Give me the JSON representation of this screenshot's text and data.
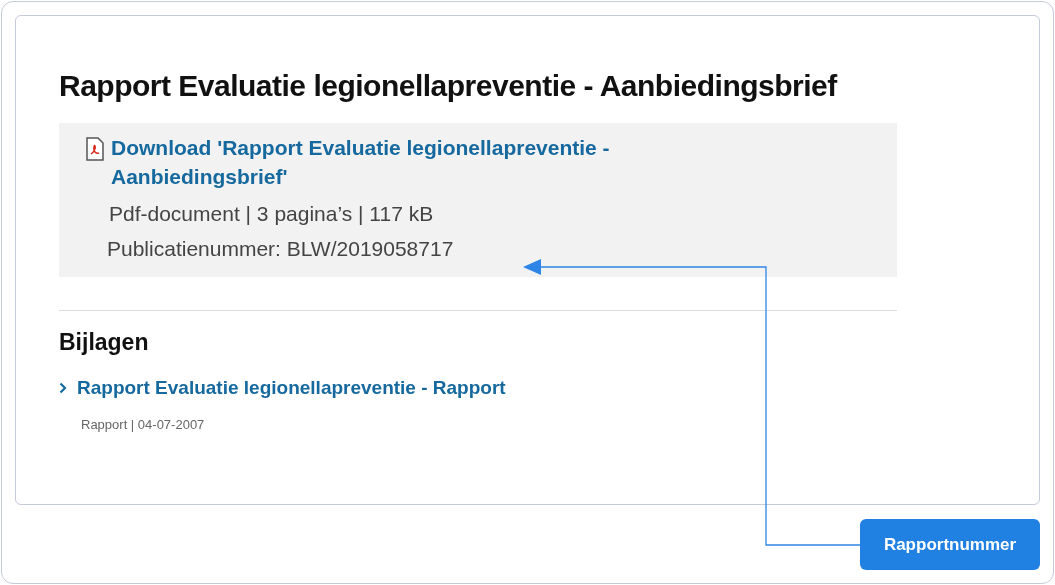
{
  "page": {
    "title": "Rapport Evaluatie legionellapreventie - Aanbiedingsbrief"
  },
  "download": {
    "link": "Download 'Rapport Evaluatie legionellapreventie - Aanbiedingsbrief'",
    "meta": "Pdf-document | 3 pagina’s | 117 kB",
    "publication_number": "Publicatienummer: BLW/2019058717"
  },
  "attachments": {
    "heading": "Bijlagen",
    "items": [
      {
        "title": "Rapport Evaluatie legionellapreventie - Rapport",
        "meta": "Rapport | 04-07-2007"
      }
    ]
  },
  "annotation": {
    "label": "Rapportnummer"
  }
}
